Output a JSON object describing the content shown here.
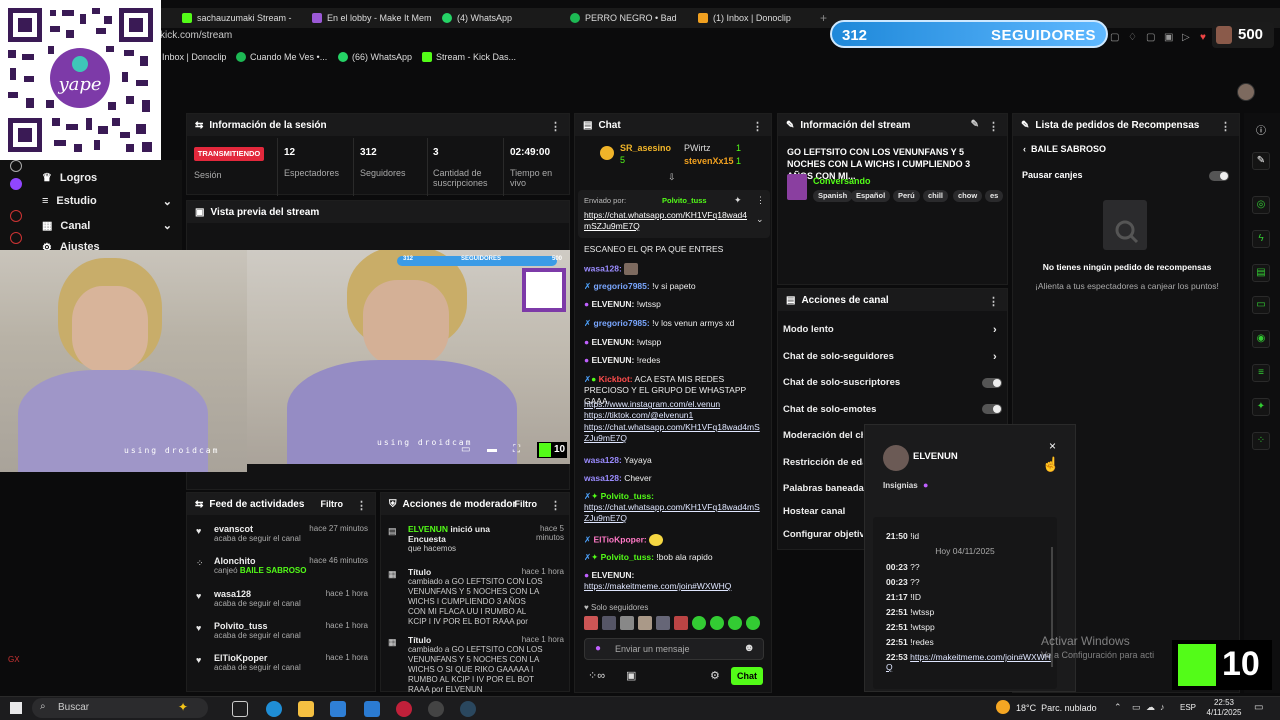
{
  "browser": {
    "tabs": [
      {
        "label": "sachauzumaki Stream - ",
        "color": "#53fc18"
      },
      {
        "label": "En el lobby - Make It Mem",
        "color": "#9b59d6"
      },
      {
        "label": "(4) WhatsApp",
        "color": "#25d366"
      },
      {
        "label": "PERRO NEGRO • Bad",
        "color": "#1db954"
      },
      {
        "label": "(1) Inbox | Donoclip",
        "color": "#f0a020"
      }
    ],
    "url": "kick.com/stream",
    "bookmarks": [
      {
        "label": "Inbox | Donoclip"
      },
      {
        "label": "Cuando Me Ves •..."
      },
      {
        "label": "(66) WhatsApp"
      },
      {
        "label": "Stream - Kick Das..."
      }
    ]
  },
  "overlay": {
    "follower_count": "312",
    "follower_label": "SEGUIDORES",
    "goal_value": "500",
    "kick_badge_count": "10"
  },
  "qr": {
    "brand": "yape"
  },
  "left_nav": {
    "items": [
      {
        "label": "Logros"
      },
      {
        "label": "Estudio"
      },
      {
        "label": "Canal"
      },
      {
        "label": "Ajustes"
      }
    ]
  },
  "session": {
    "title": "Información de la sesión",
    "live_badge": "TRANSMITIENDO",
    "live_sub": "Sesión",
    "viewers": "12",
    "viewers_label": "Espectadores",
    "followers": "312",
    "followers_label": "Seguidores",
    "subs": "3",
    "subs_label": "Cantidad de suscripciones",
    "time": "02:49:00",
    "time_label": "Tiempo en vivo"
  },
  "preview": {
    "title": "Vista previa del stream",
    "cam_text": "using droidcam",
    "mini_followers": "312",
    "mini_label": "SEGUIDORES",
    "mini_goal": "500",
    "kick_count": "10"
  },
  "chat": {
    "title": "Chat",
    "top_users": [
      {
        "name": "SR_asesino",
        "count": "5"
      },
      {
        "name": "PWirtz",
        "count": "1"
      },
      {
        "name": "stevenXx15",
        "count": "1"
      }
    ],
    "pinned_by_label": "Enviado por:",
    "pinned_by": "Polvito_tuss",
    "pinned_link": "https://chat.whatsapp.com/KH1VFq18wad4mSZJu9mE7Q",
    "partial_top": "ESCANEO EL QR PA QUE ENTRES",
    "messages": [
      {
        "user": "wasa128:",
        "text": "",
        "color": "#9b8cff"
      },
      {
        "user": "gregorio7985:",
        "text": "!v si papeto",
        "color": "#7aa7ff"
      },
      {
        "user": "ELVENUN:",
        "text": "!wtssp",
        "color": "#ffffff"
      },
      {
        "user": "gregorio7985:",
        "text": "!v los venun armys xd",
        "color": "#7aa7ff"
      },
      {
        "user": "ELVENUN:",
        "text": "!wtspp",
        "color": "#ffffff"
      },
      {
        "user": "ELVENUN:",
        "text": "!redes",
        "color": "#ffffff"
      },
      {
        "user": "Kickbot:",
        "text": "ACA ESTA MIS REDES PRECIOSO Y EL GRUPO DE WHASTAPP GAAA",
        "color": "#ff4d4d"
      },
      {
        "user": "",
        "text": "https://www.instagram.com/el.venun",
        "color": ""
      },
      {
        "user": "",
        "text": "https://tiktok.com/@elvenun1",
        "color": ""
      },
      {
        "user": "",
        "text": "https://chat.whatsapp.com/KH1VFq18wad4mSZJu9mE7Q",
        "color": ""
      },
      {
        "user": "wasa128:",
        "text": "Yayaya",
        "color": "#9b8cff"
      },
      {
        "user": "wasa128:",
        "text": "Chever",
        "color": "#9b8cff"
      },
      {
        "user": "Polvito_tuss:",
        "text": "https://chat.whatsapp.com/KH1VFq18wad4mSZJu9mE7Q",
        "color": "#53fc18"
      },
      {
        "user": "ElTioKpoper:",
        "text": "",
        "color": "#ff79c6"
      },
      {
        "user": "Polvito_tuss:",
        "text": "!bob ala rapido",
        "color": "#53fc18"
      },
      {
        "user": "ELVENUN:",
        "text": "https://makeitmeme.com/join#WXWHQ",
        "color": "#ffffff"
      }
    ],
    "followers_only": "Solo seguidores",
    "input_placeholder": "Enviar un mensaje",
    "send_label": "Chat"
  },
  "stream_info": {
    "title": "Información del stream",
    "stream_title": "GO LEFTSITO CON LOS VENUNFANS Y 5 NOCHES CON LA WICHS I CUMPLIENDO 3 AÑOS CON MI...",
    "category": "Conversando",
    "tags": [
      "Spanish",
      "Español",
      "Perú",
      "chill",
      "chow",
      "es"
    ]
  },
  "channel_actions": {
    "title": "Acciones de canal",
    "items": [
      {
        "label": "Modo lento",
        "control": "chevron"
      },
      {
        "label": "Chat de solo-seguidores",
        "control": "chevron"
      },
      {
        "label": "Chat de solo-suscriptores",
        "control": "toggle"
      },
      {
        "label": "Chat de solo-emotes",
        "control": "toggle"
      },
      {
        "label": "Moderación del cha",
        "control": ""
      },
      {
        "label": "Restricción de edad",
        "control": ""
      },
      {
        "label": "Palabras baneadas",
        "control": ""
      },
      {
        "label": "Hostear canal",
        "control": ""
      },
      {
        "label": "Configurar objetivo",
        "control": ""
      }
    ]
  },
  "rewards": {
    "title": "Lista de pedidos de Recompensas",
    "filter": "BAILE SABROSO",
    "pause_label": "Pausar canjes",
    "empty_title": "No tienes ningún pedido de recompensas",
    "empty_sub": "¡Alienta a tus espectadores a canjear los puntos!"
  },
  "feed": {
    "title": "Feed de actividades",
    "filter": "Filtro",
    "items": [
      {
        "name": "evanscot",
        "sub": "acaba de seguir el canal",
        "time": "hace 27 minutos"
      },
      {
        "name": "Alonchito",
        "sub": "canjeó",
        "highlight": "BAILE SABROSO",
        "time": "hace 46 minutos"
      },
      {
        "name": "wasa128",
        "sub": "acaba de seguir el canal",
        "time": "hace 1 hora"
      },
      {
        "name": "Polvito_tuss",
        "sub": "acaba de seguir el canal",
        "time": "hace 1 hora"
      },
      {
        "name": "ElTioKpoper",
        "sub": "acaba de seguir el canal",
        "time": "hace 1 hora"
      }
    ]
  },
  "mod": {
    "title": "Acciones de moderador",
    "filter": "Filtro",
    "items": [
      {
        "name": "ELVENUN",
        "name2": " inició una Encuesta",
        "sub": "que hacemos",
        "time": "hace 5 minutos"
      },
      {
        "name": "Título",
        "sub": "cambiado a GO LEFTSITO CON LOS VENUNFANS Y 5 NOCHES CON LA WICHS I CUMPLIENDO 3 AÑOS CON MI FLACA UU I RUMBO AL KCIP I IV POR EL BOT RAAA por ELVENUN",
        "time": "hace 1 hora"
      },
      {
        "name": "Título",
        "sub": "cambiado a GO LEFTSITO CON LOS VENUNFANS Y 5 NOCHES CON LA WICHS O SI QUE RIKO GAAAAA I RUMBO AL KCIP I IV POR EL BOT RAAA por ELVENUN",
        "time": "hace 1 hora"
      }
    ]
  },
  "usercard": {
    "name": "ELVENUN",
    "badges_label": "Insignias",
    "date_sep": "Hoy 04/11/2025",
    "log": [
      {
        "time": "21:50",
        "text": "!id"
      },
      {
        "time": "00:23",
        "text": "??"
      },
      {
        "time": "00:23",
        "text": "??"
      },
      {
        "time": "21:17",
        "text": "!ID"
      },
      {
        "time": "22:51",
        "text": "!wtssp"
      },
      {
        "time": "22:51",
        "text": "!wtspp"
      },
      {
        "time": "22:51",
        "text": "!redes"
      },
      {
        "time": "22:53",
        "text": "https://makeitmeme.com/join#WXWHQ"
      }
    ]
  },
  "windows_watermark": {
    "title": "Activar Windows",
    "sub": "Ve a Configuración para acti"
  },
  "taskbar": {
    "search": "Buscar",
    "weather": "18°C  Parc. nublado",
    "lang": "ESP",
    "time": "22:53",
    "date": "4/11/2025"
  }
}
